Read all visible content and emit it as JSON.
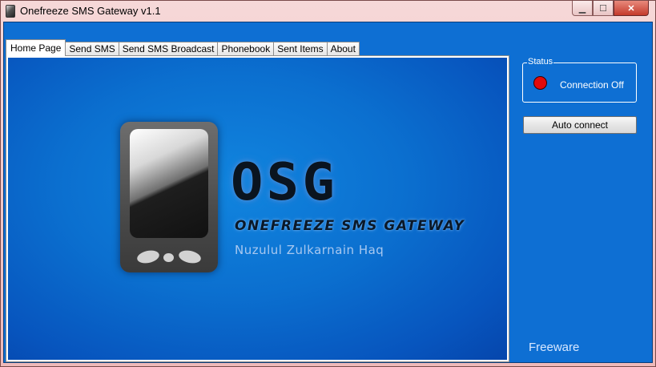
{
  "window": {
    "title": "Onefreeze SMS Gateway v1.1",
    "minimize_glyph": "▁",
    "maximize_glyph": "☐",
    "close_glyph": "✕"
  },
  "tabs": [
    {
      "label": "Home Page",
      "active": true
    },
    {
      "label": "Send SMS",
      "active": false
    },
    {
      "label": "Send SMS Broadcast",
      "active": false
    },
    {
      "label": "Phonebook",
      "active": false
    },
    {
      "label": "Sent Items",
      "active": false
    },
    {
      "label": "About",
      "active": false
    }
  ],
  "splash": {
    "logo": "OSG",
    "subtitle": "ONEFREEZE SMS GATEWAY",
    "author": "Nuzulul Zulkarnain Haq"
  },
  "status": {
    "group_label": "Status",
    "connection_label": "Connection",
    "connection_value": "Off",
    "indicator_color": "#e30a0a"
  },
  "auto_connect_label": "Auto connect",
  "footer_text": "Freeware",
  "colors": {
    "panel_blue": "#0e6fd3",
    "title_bar": "#efb9b9",
    "status_off": "#e30a0a"
  },
  "icons": {
    "app": "phone-app-icon",
    "status": "status-indicator-icon"
  }
}
